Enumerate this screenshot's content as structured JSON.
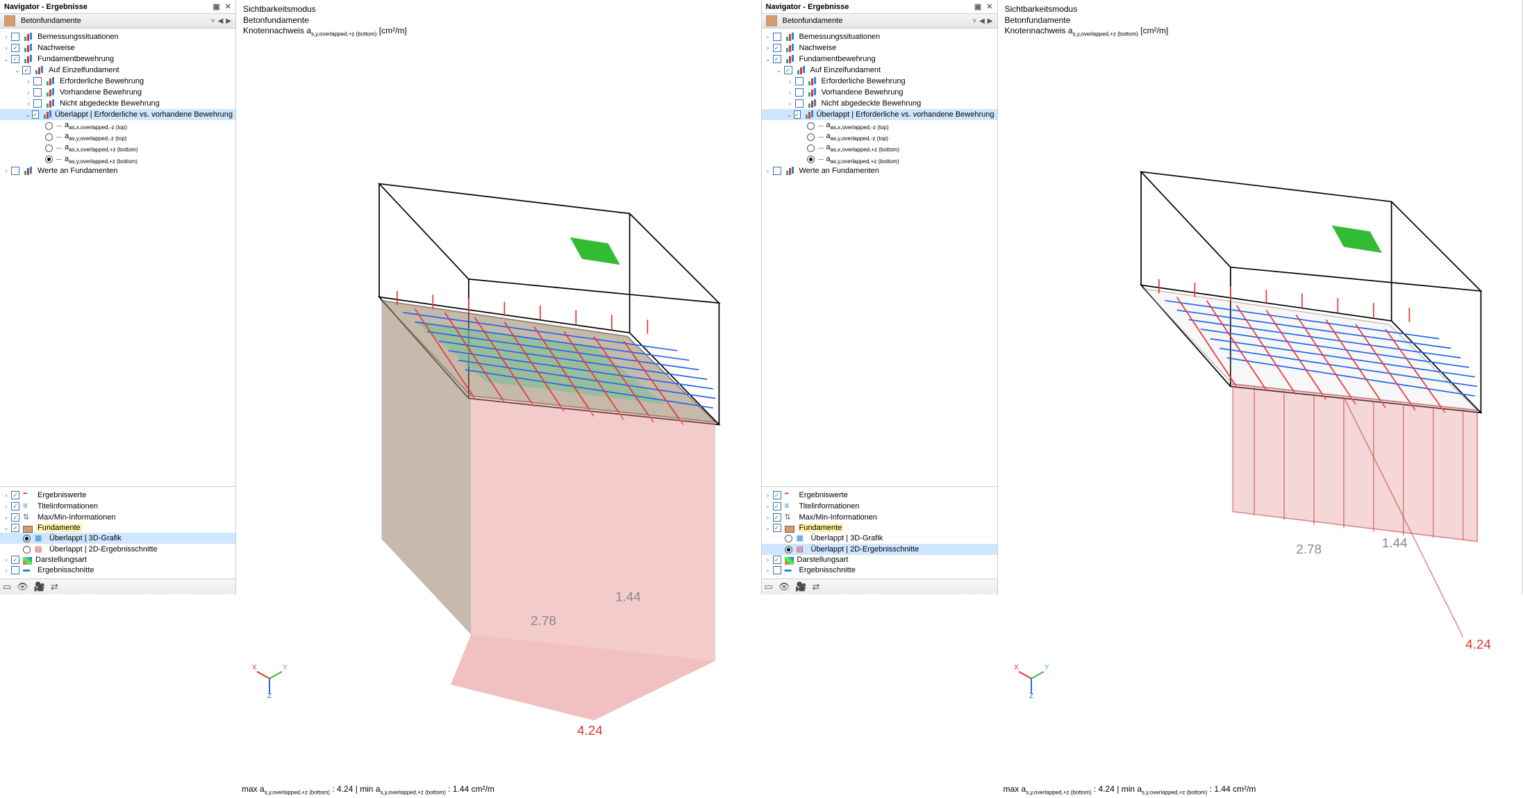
{
  "panel_title": "Navigator - Ergebnisse",
  "category": "Betonfundamente",
  "tree1": {
    "bem": "Bemessungssituationen",
    "nach": "Nachweise",
    "fund": "Fundamentbewehrung",
    "auf": "Auf Einzelfundament",
    "erf": "Erforderliche Bewehrung",
    "vorh": "Vorhandene Bewehrung",
    "nabg": "Nicht abgedeckte Bewehrung",
    "uber": "Überlappt | Erforderliche vs. vorhandene Bewehrung",
    "o1": "as,x,overlapped,-z (top)",
    "o2": "as,y,overlapped,-z (top)",
    "o3": "as,x,overlapped,+z (bottom)",
    "o4": "as,y,overlapped,+z (bottom)",
    "werte": "Werte an Fundamenten"
  },
  "tree2": {
    "erg": "Ergebniswerte",
    "tit": "Titelinformationen",
    "mm": "Max/Min-Informationen",
    "fund": "Fundamente",
    "g3d": "Überlappt | 3D-Grafik",
    "g2d": "Überlappt | 2D-Ergebnisschnitte",
    "dar": "Darstellungsart",
    "sch": "Ergebnisschnitte"
  },
  "vp": {
    "l1": "Sichtbarkeitsmodus",
    "l2": "Betonfundamente",
    "l3_pre": "Knotennachweis a",
    "l3_sub": "s,y,overlapped,+z (bottom)",
    "l3_unit": " [cm²/m]"
  },
  "values": {
    "v1": "2.78",
    "v2": "1.44",
    "v3": "4.24"
  },
  "axes": {
    "x": "X",
    "y": "Y",
    "z": "Z"
  },
  "status": {
    "max_lbl": "max a",
    "min_lbl": "min a",
    "sub": "s,y,overlapped,+z (bottom)",
    "max_v": "4.24",
    "min_v": "1.44",
    "unit": "cm²/m"
  }
}
